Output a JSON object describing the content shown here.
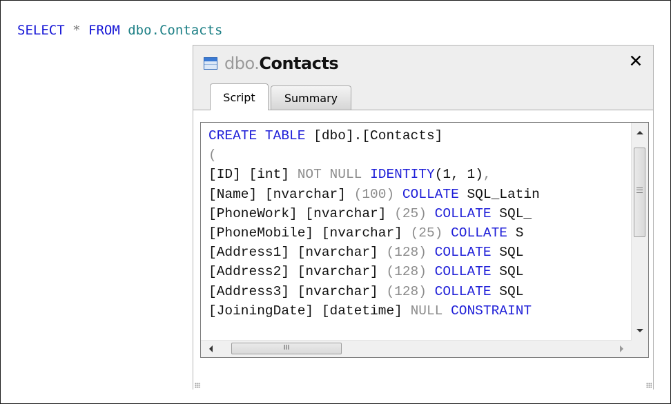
{
  "query": {
    "select_kw": "SELECT",
    "star": "*",
    "from_kw": "FROM",
    "object": "dbo.Contacts"
  },
  "popup": {
    "title_schema": "dbo.",
    "title_name": "Contacts",
    "close_symbol": "✕",
    "icon": "table-icon",
    "tabs": [
      {
        "label": "Script",
        "active": true
      },
      {
        "label": "Summary",
        "active": false
      }
    ]
  },
  "script_lines": [
    [
      {
        "t": "CREATE TABLE",
        "c": "kw"
      },
      {
        "t": " [dbo].[Contacts]",
        "c": "txt"
      }
    ],
    [
      {
        "t": "(",
        "c": "gray"
      }
    ],
    [
      {
        "t": "[ID] [int] ",
        "c": "txt"
      },
      {
        "t": "NOT NULL ",
        "c": "gray"
      },
      {
        "t": "IDENTITY",
        "c": "kw"
      },
      {
        "t": "(1, 1)",
        "c": "txt"
      },
      {
        "t": ",",
        "c": "gray"
      }
    ],
    [
      {
        "t": "[Name] [nvarchar] ",
        "c": "txt"
      },
      {
        "t": "(100) ",
        "c": "gray"
      },
      {
        "t": "COLLATE",
        "c": "kw"
      },
      {
        "t": " SQL_Latin",
        "c": "txt"
      }
    ],
    [
      {
        "t": "[PhoneWork] [nvarchar] ",
        "c": "txt"
      },
      {
        "t": "(25) ",
        "c": "gray"
      },
      {
        "t": "COLLATE",
        "c": "kw"
      },
      {
        "t": " SQL_",
        "c": "txt"
      }
    ],
    [
      {
        "t": "[PhoneMobile] [nvarchar] ",
        "c": "txt"
      },
      {
        "t": "(25) ",
        "c": "gray"
      },
      {
        "t": "COLLATE",
        "c": "kw"
      },
      {
        "t": " S",
        "c": "txt"
      }
    ],
    [
      {
        "t": "[Address1] [nvarchar] ",
        "c": "txt"
      },
      {
        "t": "(128) ",
        "c": "gray"
      },
      {
        "t": "COLLATE",
        "c": "kw"
      },
      {
        "t": " SQL",
        "c": "txt"
      }
    ],
    [
      {
        "t": "[Address2] [nvarchar] ",
        "c": "txt"
      },
      {
        "t": "(128) ",
        "c": "gray"
      },
      {
        "t": "COLLATE",
        "c": "kw"
      },
      {
        "t": " SQL",
        "c": "txt"
      }
    ],
    [
      {
        "t": "[Address3] [nvarchar] ",
        "c": "txt"
      },
      {
        "t": "(128) ",
        "c": "gray"
      },
      {
        "t": "COLLATE",
        "c": "kw"
      },
      {
        "t": " SQL",
        "c": "txt"
      }
    ],
    [
      {
        "t": "[JoiningDate] [datetime] ",
        "c": "txt"
      },
      {
        "t": "NULL ",
        "c": "gray"
      },
      {
        "t": "CONSTRAINT",
        "c": "kw"
      }
    ]
  ],
  "scrollbars": {
    "vertical_grip": "≡",
    "horizontal_grip": "III"
  },
  "colors": {
    "keyword": "#1f1fd8",
    "gray": "#8c8c8c",
    "text": "#111111",
    "object": "#1c7f85"
  }
}
